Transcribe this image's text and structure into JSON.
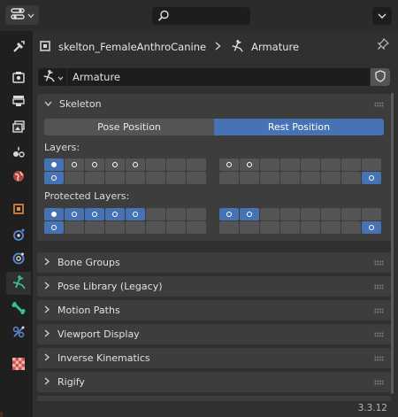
{
  "header": {
    "editor_type_icon": "properties-editor-icon",
    "search_placeholder": "",
    "options_icon": "chevron-down-icon"
  },
  "tabs": [
    {
      "name": "tool-icon",
      "color": "#d9d9d9"
    },
    {
      "name": "render-icon",
      "color": "#d9d9d9"
    },
    {
      "name": "output-icon",
      "color": "#d9d9d9"
    },
    {
      "name": "view-layer-icon",
      "color": "#d9d9d9"
    },
    {
      "name": "scene-icon",
      "color": "#d9d9d9"
    },
    {
      "name": "world-icon",
      "color": "#d9524c"
    },
    {
      "name": "object-icon",
      "color": "#e78f3b"
    },
    {
      "name": "modifiers-icon",
      "color": "#5a89d6"
    },
    {
      "name": "physics-icon",
      "color": "#5a89d6"
    },
    {
      "name": "object-data-armature-icon",
      "color": "#38c08a"
    },
    {
      "name": "bone-icon",
      "color": "#38c08a"
    },
    {
      "name": "bone-constraint-icon",
      "color": "#5a89d6"
    },
    {
      "name": "texture-icon",
      "color": "#c8524a"
    }
  ],
  "breadcrumb": {
    "object_name": "skelton_FemaleAnthroCanine",
    "data_name": "Armature"
  },
  "datablock": {
    "name": "Armature"
  },
  "skeleton": {
    "title": "Skeleton",
    "pose_position_label": "Pose Position",
    "rest_position_label": "Rest Position",
    "active_position": "Rest Position",
    "layers_label": "Layers:",
    "protected_layers_label": "Protected Layers:",
    "layers_active": [
      0,
      1,
      2,
      3,
      4,
      8,
      9,
      16,
      31
    ],
    "layers_selected": [
      0,
      16,
      31
    ],
    "protected_active": [
      0,
      1,
      2,
      3,
      4,
      8,
      9,
      16,
      31
    ],
    "protected_selected": [
      0,
      1,
      2,
      3,
      4,
      8,
      9,
      16,
      31
    ]
  },
  "panels": [
    {
      "label": "Bone Groups"
    },
    {
      "label": "Pose Library (Legacy)"
    },
    {
      "label": "Motion Paths"
    },
    {
      "label": "Viewport Display"
    },
    {
      "label": "Inverse Kinematics"
    },
    {
      "label": "Rigify"
    }
  ],
  "colors": {
    "accent": "#4772b3",
    "panel_bg": "#3d3d3d",
    "editor_bg": "#303030"
  },
  "version": "3.3.12"
}
